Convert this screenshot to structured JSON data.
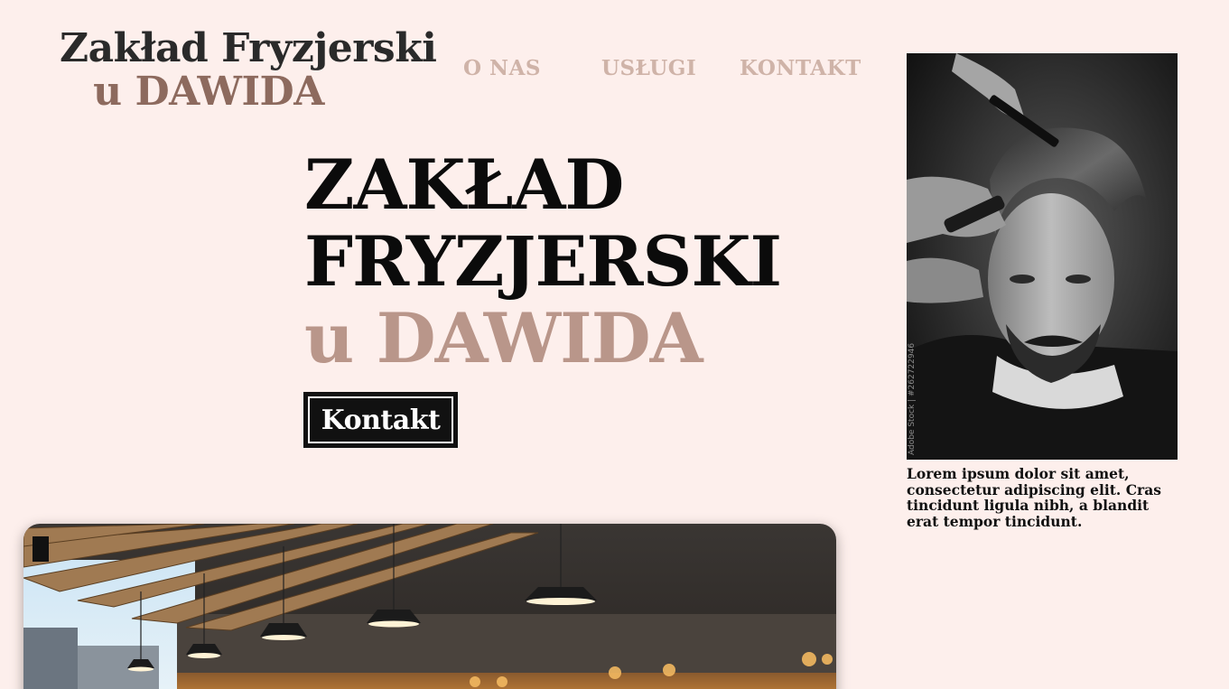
{
  "logo": {
    "line1": "Zakład Fryzjerski",
    "line2": "u DAWIDA"
  },
  "nav": {
    "items": [
      {
        "label": "O NAS"
      },
      {
        "label": "USŁUGI"
      },
      {
        "label": "KONTAKT"
      }
    ]
  },
  "hero": {
    "line1": "ZAKŁAD",
    "line2": "FRYZJERSKI",
    "line3": "u DAWIDA",
    "cta_label": "Kontakt"
  },
  "sidebar": {
    "caption": "Lorem ipsum dolor sit amet, consectetur adipiscing elit. Cras tincidunt ligula nibh, a blandit erat tempor tincidunt.",
    "watermark": "Adobe Stock | #262722946"
  },
  "colors": {
    "background": "#fdefec",
    "accent_dark": "#8d6a5e",
    "accent_light": "#b9968a",
    "nav": "#cfb3a8",
    "button": "#111111"
  }
}
